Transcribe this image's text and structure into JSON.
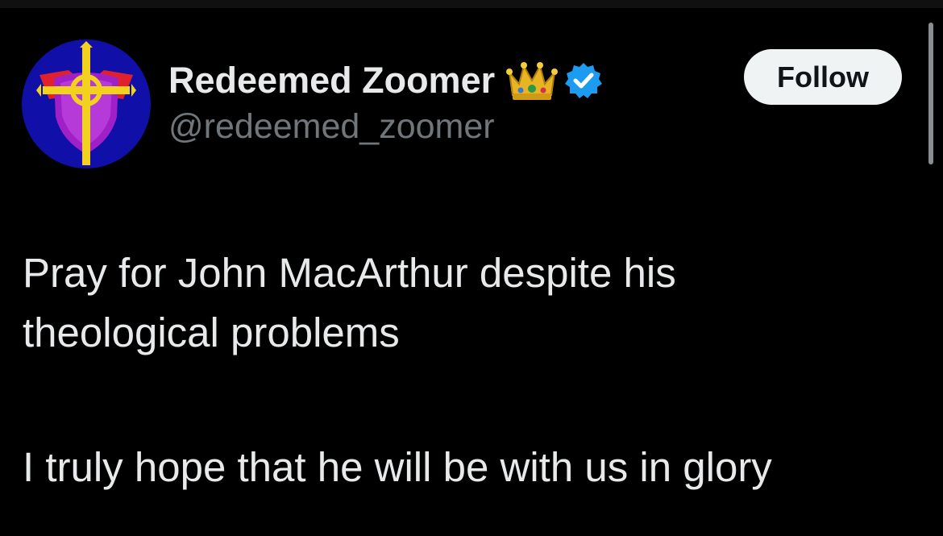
{
  "author": {
    "display_name": "Redeemed Zoomer",
    "handle": "@redeemed_zoomer",
    "badges": [
      "crown-icon",
      "verified-icon"
    ]
  },
  "follow_button": {
    "label": "Follow"
  },
  "tweet": {
    "lines": [
      "Pray for John MacArthur despite his",
      "theological problems",
      "I truly hope that he will be with us in glory"
    ]
  },
  "colors": {
    "background": "#000000",
    "text_primary": "#e7e9ea",
    "text_secondary": "#71767b",
    "follow_button_bg": "#eff3f4",
    "verified_blue": "#1d9bf0",
    "avatar_ring": "#1010a8",
    "avatar_shield": "#a020c8",
    "avatar_red": "#e0202c",
    "avatar_cross": "#f2d21e"
  }
}
